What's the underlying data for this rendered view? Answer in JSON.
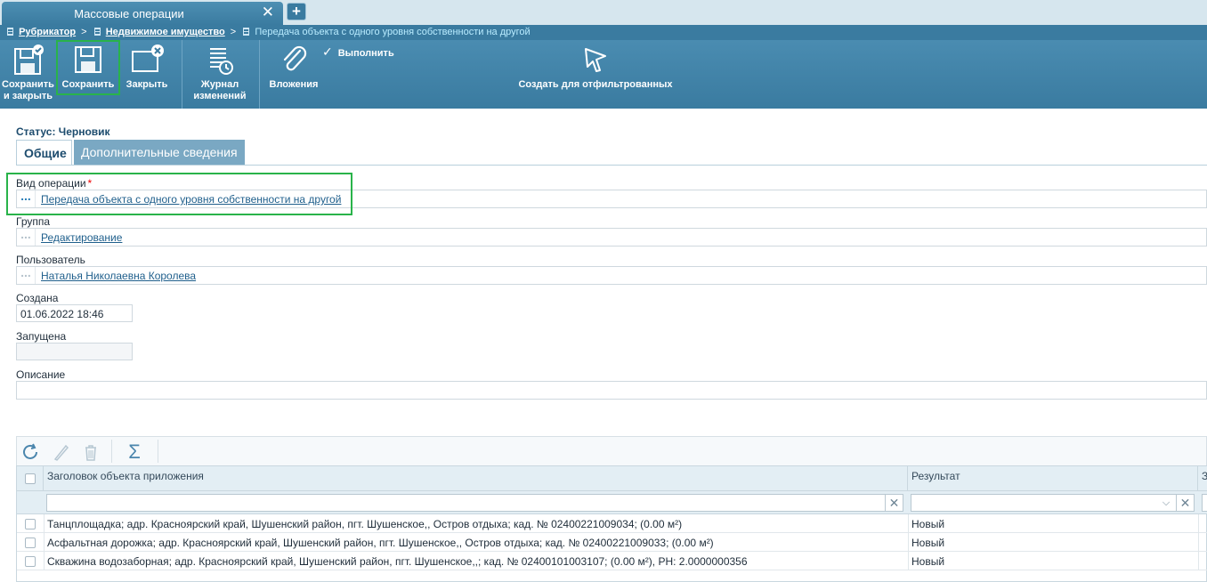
{
  "window": {
    "tab_title": "Массовые операции",
    "tab_close": "✕",
    "tab_add": "+"
  },
  "breadcrumb": {
    "items": [
      "Рубрикатор",
      "Недвижимое имущество"
    ],
    "separator": ">",
    "current": "Передача объекта с одного уровня собственности на другой"
  },
  "toolbar": {
    "save_close": "Сохранить и закрыть",
    "save": "Сохранить",
    "close": "Закрыть",
    "journal": "Журнал изменений",
    "attachments": "Вложения",
    "execute": "Выполнить",
    "create_filtered": "Создать для отфильтрованных"
  },
  "form": {
    "status": "Статус: Черновик",
    "tabs": [
      "Общие",
      "Дополнительные сведения"
    ],
    "operation_type_label": "Вид операции",
    "required_mark": "*",
    "operation_type_value": "Передача объекта с одного уровня собственности на другой",
    "group_label": "Группа",
    "group_value": "Редактирование",
    "user_label": "Пользователь",
    "user_value": "Наталья Николаевна Королева",
    "created_label": "Создана",
    "created_value": "01.06.2022 18:46",
    "started_label": "Запущена",
    "started_value": "",
    "description_label": "Описание",
    "lookup_dots": "..."
  },
  "grid": {
    "tools": [
      "refresh-icon",
      "edit-icon",
      "delete-icon",
      "sum-icon"
    ],
    "sum_symbol": "Σ",
    "columns": [
      "Заголовок объекта приложения",
      "Результат",
      "З"
    ],
    "filter_clear": "✕",
    "filter_dropdown": "⌵",
    "rows": [
      {
        "title": "Танцплощадка; адр. Красноярский край, Шушенский район, пгт. Шушенское,, Остров отдыха; кад. № 02400221009034; (0.00 м²)",
        "result": "Новый"
      },
      {
        "title": "Асфальтная дорожка; адр. Красноярский край, Шушенский район, пгт. Шушенское,, Остров отдыха; кад. № 02400221009033; (0.00 м²)",
        "result": "Новый"
      },
      {
        "title": "Скважина водозаборная; адр. Красноярский край, Шушенский район, пгт. Шушенское,,; кад. № 02400101003107; (0.00 м²), РН: 2.0000000356",
        "result": "Новый"
      }
    ]
  },
  "colors": {
    "toolbar_bg": "#3a7ba0",
    "highlight": "#29b34a",
    "link": "#1f5f8c"
  }
}
